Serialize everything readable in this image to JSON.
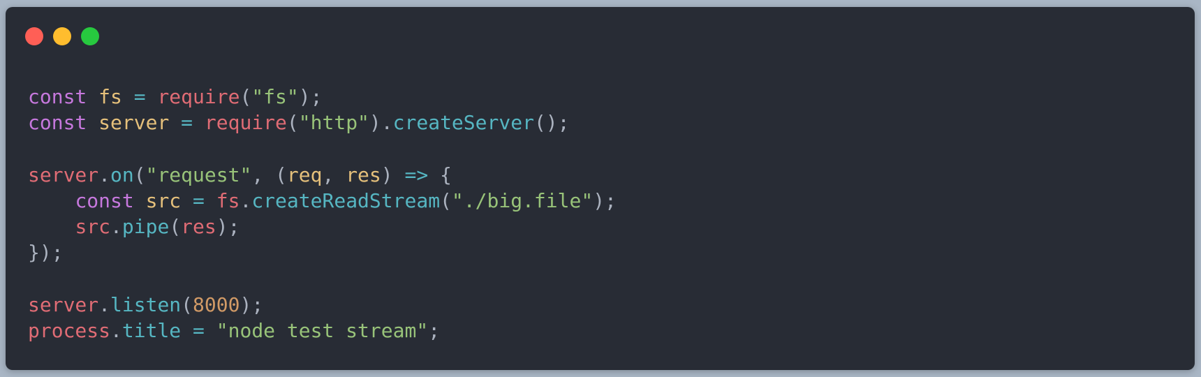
{
  "window": {
    "traffic_lights": [
      "close-icon",
      "minimize-icon",
      "maximize-icon"
    ],
    "colors": {
      "background": "#282c35",
      "page_background": "#a9b6c5",
      "close": "#ff5f56",
      "minimize": "#ffbd2e",
      "maximize": "#27c93f"
    }
  },
  "code": {
    "language": "javascript",
    "lines": [
      [
        {
          "t": "const",
          "k": "kw"
        },
        {
          "t": " ",
          "k": "ws"
        },
        {
          "t": "fs",
          "k": "var"
        },
        {
          "t": " ",
          "k": "ws"
        },
        {
          "t": "=",
          "k": "op"
        },
        {
          "t": " ",
          "k": "ws"
        },
        {
          "t": "require",
          "k": "fn"
        },
        {
          "t": "(",
          "k": "punc"
        },
        {
          "t": "\"fs\"",
          "k": "str"
        },
        {
          "t": ");",
          "k": "punc"
        }
      ],
      [
        {
          "t": "const",
          "k": "kw"
        },
        {
          "t": " ",
          "k": "ws"
        },
        {
          "t": "server",
          "k": "var"
        },
        {
          "t": " ",
          "k": "ws"
        },
        {
          "t": "=",
          "k": "op"
        },
        {
          "t": " ",
          "k": "ws"
        },
        {
          "t": "require",
          "k": "fn"
        },
        {
          "t": "(",
          "k": "punc"
        },
        {
          "t": "\"http\"",
          "k": "str"
        },
        {
          "t": ").",
          "k": "punc"
        },
        {
          "t": "createServer",
          "k": "meth"
        },
        {
          "t": "();",
          "k": "punc"
        }
      ],
      [],
      [
        {
          "t": "server",
          "k": "obj"
        },
        {
          "t": ".",
          "k": "punc"
        },
        {
          "t": "on",
          "k": "meth"
        },
        {
          "t": "(",
          "k": "punc"
        },
        {
          "t": "\"request\"",
          "k": "str"
        },
        {
          "t": ", (",
          "k": "punc"
        },
        {
          "t": "req",
          "k": "var"
        },
        {
          "t": ", ",
          "k": "punc"
        },
        {
          "t": "res",
          "k": "var"
        },
        {
          "t": ") ",
          "k": "punc"
        },
        {
          "t": "=>",
          "k": "op"
        },
        {
          "t": " {",
          "k": "punc"
        }
      ],
      [
        {
          "t": "    ",
          "k": "ws"
        },
        {
          "t": "const",
          "k": "kw"
        },
        {
          "t": " ",
          "k": "ws"
        },
        {
          "t": "src",
          "k": "var"
        },
        {
          "t": " ",
          "k": "ws"
        },
        {
          "t": "=",
          "k": "op"
        },
        {
          "t": " ",
          "k": "ws"
        },
        {
          "t": "fs",
          "k": "obj"
        },
        {
          "t": ".",
          "k": "punc"
        },
        {
          "t": "createReadStream",
          "k": "meth"
        },
        {
          "t": "(",
          "k": "punc"
        },
        {
          "t": "\"./big.file\"",
          "k": "str"
        },
        {
          "t": ");",
          "k": "punc"
        }
      ],
      [
        {
          "t": "    ",
          "k": "ws"
        },
        {
          "t": "src",
          "k": "obj"
        },
        {
          "t": ".",
          "k": "punc"
        },
        {
          "t": "pipe",
          "k": "meth"
        },
        {
          "t": "(",
          "k": "punc"
        },
        {
          "t": "res",
          "k": "obj"
        },
        {
          "t": ");",
          "k": "punc"
        }
      ],
      [
        {
          "t": "});",
          "k": "punc"
        }
      ],
      [],
      [
        {
          "t": "server",
          "k": "obj"
        },
        {
          "t": ".",
          "k": "punc"
        },
        {
          "t": "listen",
          "k": "meth"
        },
        {
          "t": "(",
          "k": "punc"
        },
        {
          "t": "8000",
          "k": "num"
        },
        {
          "t": ");",
          "k": "punc"
        }
      ],
      [
        {
          "t": "process",
          "k": "obj"
        },
        {
          "t": ".",
          "k": "punc"
        },
        {
          "t": "title",
          "k": "meth"
        },
        {
          "t": " ",
          "k": "ws"
        },
        {
          "t": "=",
          "k": "op"
        },
        {
          "t": " ",
          "k": "ws"
        },
        {
          "t": "\"node test stream\"",
          "k": "str"
        },
        {
          "t": ";",
          "k": "punc"
        }
      ]
    ]
  }
}
